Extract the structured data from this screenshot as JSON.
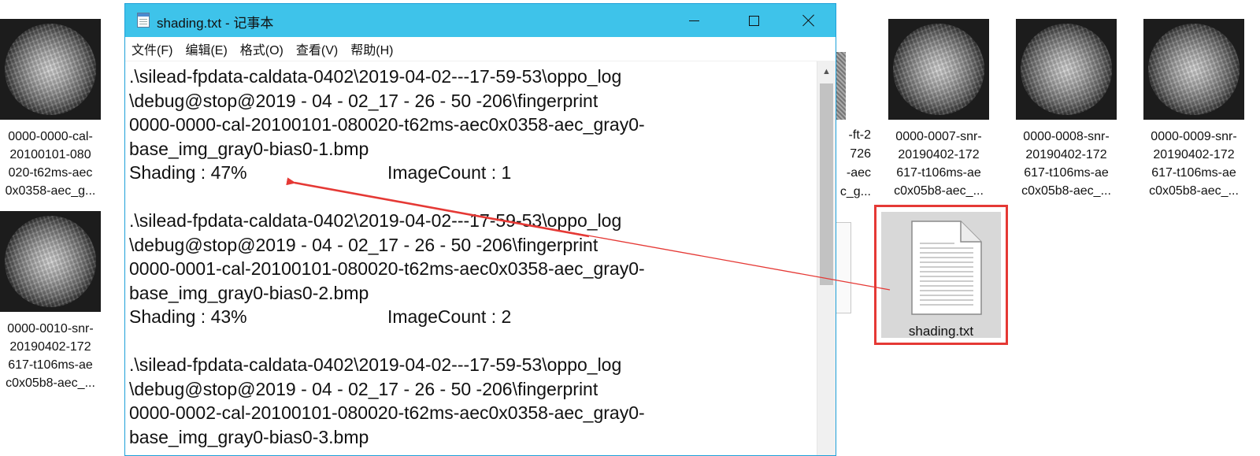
{
  "desktop": {
    "thumbnails": [
      {
        "label": "0000-0000-cal-\n20100101-080\n020-t62ms-aec\n0x0358-aec_g..."
      },
      {
        "label": "0000-0010-snr-\n20190402-172\n617-t106ms-ae\nc0x05b8-aec_..."
      },
      {
        "label": "0000-0007-snr-\n20190402-172\n617-t106ms-ae\nc0x05b8-aec_..."
      },
      {
        "label": "0000-0008-snr-\n20190402-172\n617-t106ms-ae\nc0x05b8-aec_..."
      },
      {
        "label": "0000-0009-snr-\n20190402-172\n617-t106ms-ae\nc0x05b8-aec_..."
      }
    ],
    "hidden_item_label": "-ft-2\n726\n-aec\nc_g...",
    "selected_file": {
      "label": "shading.txt"
    },
    "accent_colors": {
      "highlight_box": "#e53935",
      "titlebar": "#3ec3ea"
    }
  },
  "notepad": {
    "title": "shading.txt - 记事本",
    "menu": [
      "文件(F)",
      "编辑(E)",
      "格式(O)",
      "查看(V)",
      "帮助(H)"
    ],
    "entries": [
      {
        "lines": [
          ".\\silead-fpdata-caldata-0402\\2019-04-02---17-59-53\\oppo_log",
          "\\debug@stop@2019 - 04 - 02_17 - 26 - 50 -206\\fingerprint",
          "0000-0000-cal-20100101-080020-t62ms-aec0x0358-aec_gray0-",
          "base_img_gray0-bias0-1.bmp"
        ],
        "shading": "Shading : 47%",
        "image_count": "ImageCount : 1"
      },
      {
        "lines": [
          ".\\silead-fpdata-caldata-0402\\2019-04-02---17-59-53\\oppo_log",
          "\\debug@stop@2019 - 04 - 02_17 - 26 - 50 -206\\fingerprint",
          "0000-0001-cal-20100101-080020-t62ms-aec0x0358-aec_gray0-",
          "base_img_gray0-bias0-2.bmp"
        ],
        "shading": "Shading : 43%",
        "image_count": "ImageCount : 2"
      },
      {
        "lines": [
          ".\\silead-fpdata-caldata-0402\\2019-04-02---17-59-53\\oppo_log",
          "\\debug@stop@2019 - 04 - 02_17 - 26 - 50 -206\\fingerprint",
          "0000-0002-cal-20100101-080020-t62ms-aec0x0358-aec_gray0-",
          "base_img_gray0-bias0-3.bmp"
        ]
      }
    ]
  }
}
